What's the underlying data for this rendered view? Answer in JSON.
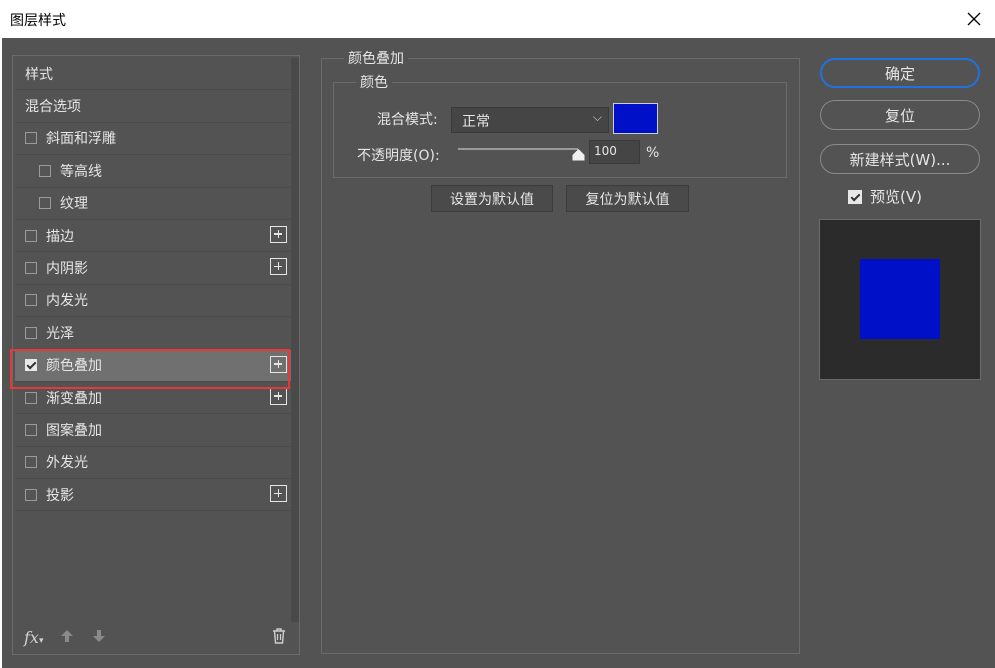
{
  "window": {
    "title": "图层样式"
  },
  "colors": {
    "overlay": "#0010c8",
    "primary_border": "#1f73e0",
    "highlight": "#e53935"
  },
  "styles": {
    "header_label": "样式",
    "blend_options_label": "混合选项",
    "items": [
      {
        "label": "斜面和浮雕",
        "checked": false,
        "plus": false,
        "sub": false
      },
      {
        "label": "等高线",
        "checked": false,
        "plus": false,
        "sub": true
      },
      {
        "label": "纹理",
        "checked": false,
        "plus": false,
        "sub": true
      },
      {
        "label": "描边",
        "checked": false,
        "plus": true,
        "sub": false
      },
      {
        "label": "内阴影",
        "checked": false,
        "plus": true,
        "sub": false
      },
      {
        "label": "内发光",
        "checked": false,
        "plus": false,
        "sub": false
      },
      {
        "label": "光泽",
        "checked": false,
        "plus": false,
        "sub": false
      },
      {
        "label": "颜色叠加",
        "checked": true,
        "plus": true,
        "sub": false,
        "selected": true
      },
      {
        "label": "渐变叠加",
        "checked": false,
        "plus": true,
        "sub": false
      },
      {
        "label": "图案叠加",
        "checked": false,
        "plus": false,
        "sub": false
      },
      {
        "label": "外发光",
        "checked": false,
        "plus": false,
        "sub": false
      },
      {
        "label": "投影",
        "checked": false,
        "plus": true,
        "sub": false
      }
    ]
  },
  "tools": {
    "fx": "fx",
    "up_icon": "arrow-up-icon",
    "down_icon": "arrow-down-icon",
    "trash_icon": "trash-icon"
  },
  "overlay": {
    "section_title": "颜色叠加",
    "group_title": "颜色",
    "blend_mode_label": "混合模式:",
    "blend_mode_value": "正常",
    "opacity_label": "不透明度(O):",
    "opacity_value": "100",
    "opacity_unit": "%",
    "opacity_fraction": 1.0,
    "set_default_label": "设置为默认值",
    "reset_default_label": "复位为默认值"
  },
  "actions": {
    "ok_label": "确定",
    "reset_label": "复位",
    "new_style_label": "新建样式(W)...",
    "preview_label": "预览(V)",
    "preview_checked": true
  }
}
